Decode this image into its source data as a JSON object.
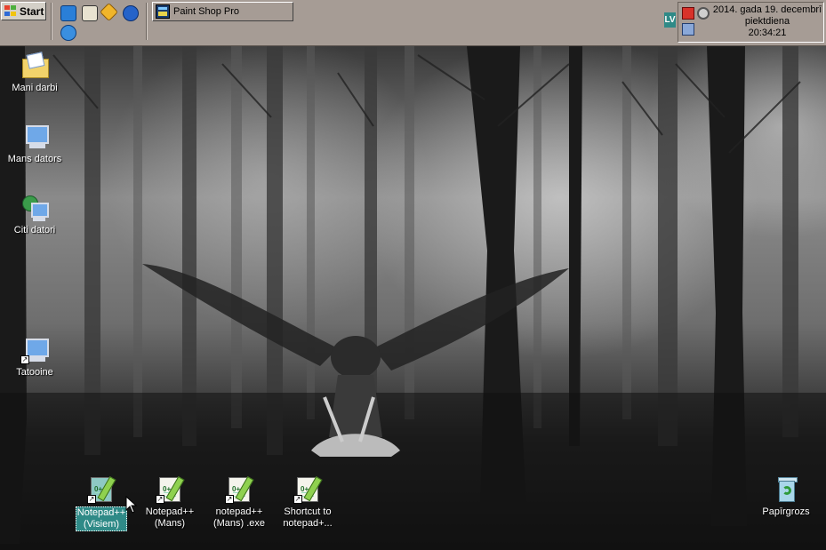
{
  "taskbar": {
    "start_label": "Start",
    "quick_launch": [
      "internet-explorer-icon",
      "media-player-icon",
      "tools-icon",
      "browser-icon",
      "messenger-icon"
    ],
    "task_button_label": "Paint Shop Pro",
    "language": "LV",
    "tray_icons": [
      "antivirus-icon",
      "clock-icon",
      "network-icon"
    ],
    "clock": {
      "date": "2014. gada 19. decembrī",
      "weekday": "piektdiena",
      "time": "20:34:21"
    }
  },
  "desktop": {
    "icons": [
      {
        "label": "Mani darbi",
        "icon": "my-documents-folder-icon"
      },
      {
        "label": "Mans dators",
        "icon": "my-computer-icon"
      },
      {
        "label": "Citi datori",
        "icon": "network-computers-icon"
      },
      {
        "label": "Tatooine",
        "icon": "computer-shortcut-icon"
      }
    ],
    "shortcuts": [
      {
        "line1": "Notepad++",
        "line2": "(Visiem)",
        "selected": true
      },
      {
        "line1": "Notepad++",
        "line2": "(Mans)",
        "selected": false
      },
      {
        "line1": "notepad++",
        "line2": "(Mans) .exe",
        "selected": false
      },
      {
        "line1": "Shortcut to",
        "line2": "notepad+...",
        "selected": false
      }
    ],
    "recycle_bin_label": "Papīrgrozs"
  },
  "colors": {
    "taskbar": "#a69c95",
    "selection": "#2f8a87",
    "language_badge": "#2f8a87"
  }
}
